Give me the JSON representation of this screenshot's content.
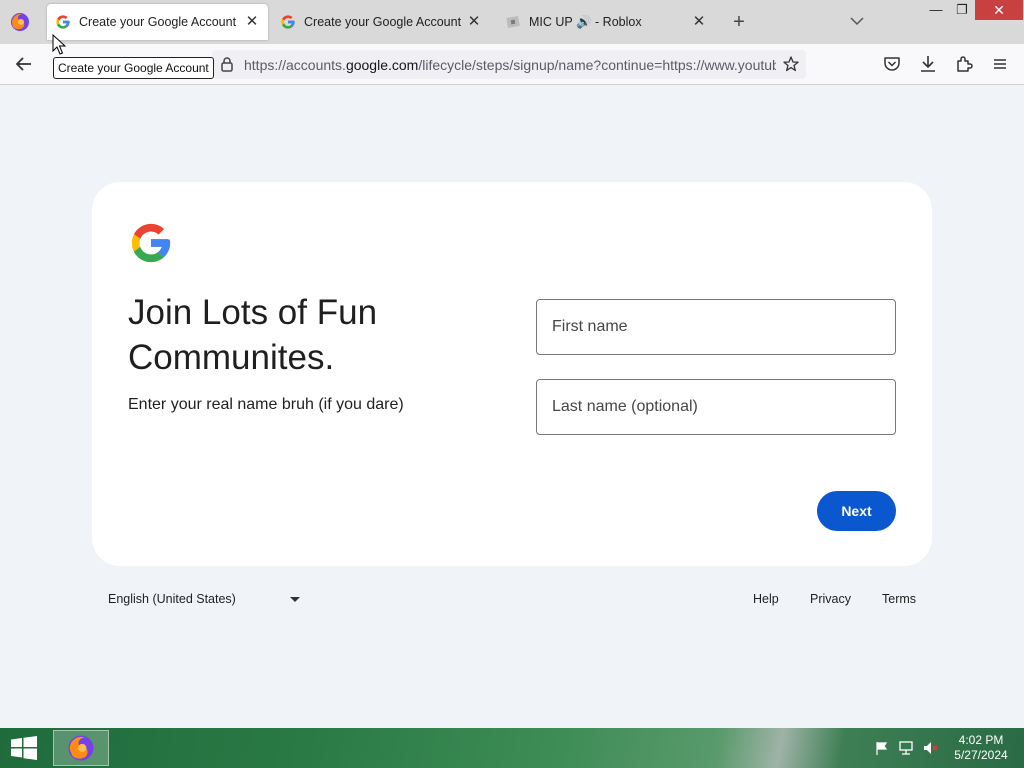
{
  "browser": {
    "tabs": [
      {
        "title": "Create your Google Account",
        "active": true,
        "favicon": "google-g-icon"
      },
      {
        "title": "Create your Google Account",
        "active": false,
        "favicon": "google-g-icon"
      },
      {
        "title": "MIC UP 🔊 - Roblox",
        "active": false,
        "favicon": "roblox-icon"
      }
    ],
    "tooltip": "Create your Google Account",
    "url_prefix": "https://accounts.",
    "url_domain": "google.com",
    "url_suffix": "/lifecycle/steps/signup/name?continue=https://www.youtube.com",
    "icons": [
      "firefox-menu-icon",
      "back-arrow-icon",
      "lock-icon",
      "bookmark-star-icon",
      "pocket-icon",
      "download-icon",
      "extensions-icon",
      "menu-icon"
    ]
  },
  "signup": {
    "heading": "Join Lots of Fun Communites.",
    "subtext": "Enter your real name bruh (if you dare)",
    "first_name_placeholder": "First name",
    "last_name_placeholder": "Last name (optional)",
    "next_label": "Next",
    "brand_colors": {
      "blue": "#4285F4",
      "red": "#EA4335",
      "yellow": "#FBBC05",
      "green": "#34A853",
      "button": "#0b57d0"
    }
  },
  "footer": {
    "language": "English (United States)",
    "help": "Help",
    "privacy": "Privacy",
    "terms": "Terms"
  },
  "taskbar": {
    "time": "4:02 PM",
    "date": "5/27/2024"
  }
}
